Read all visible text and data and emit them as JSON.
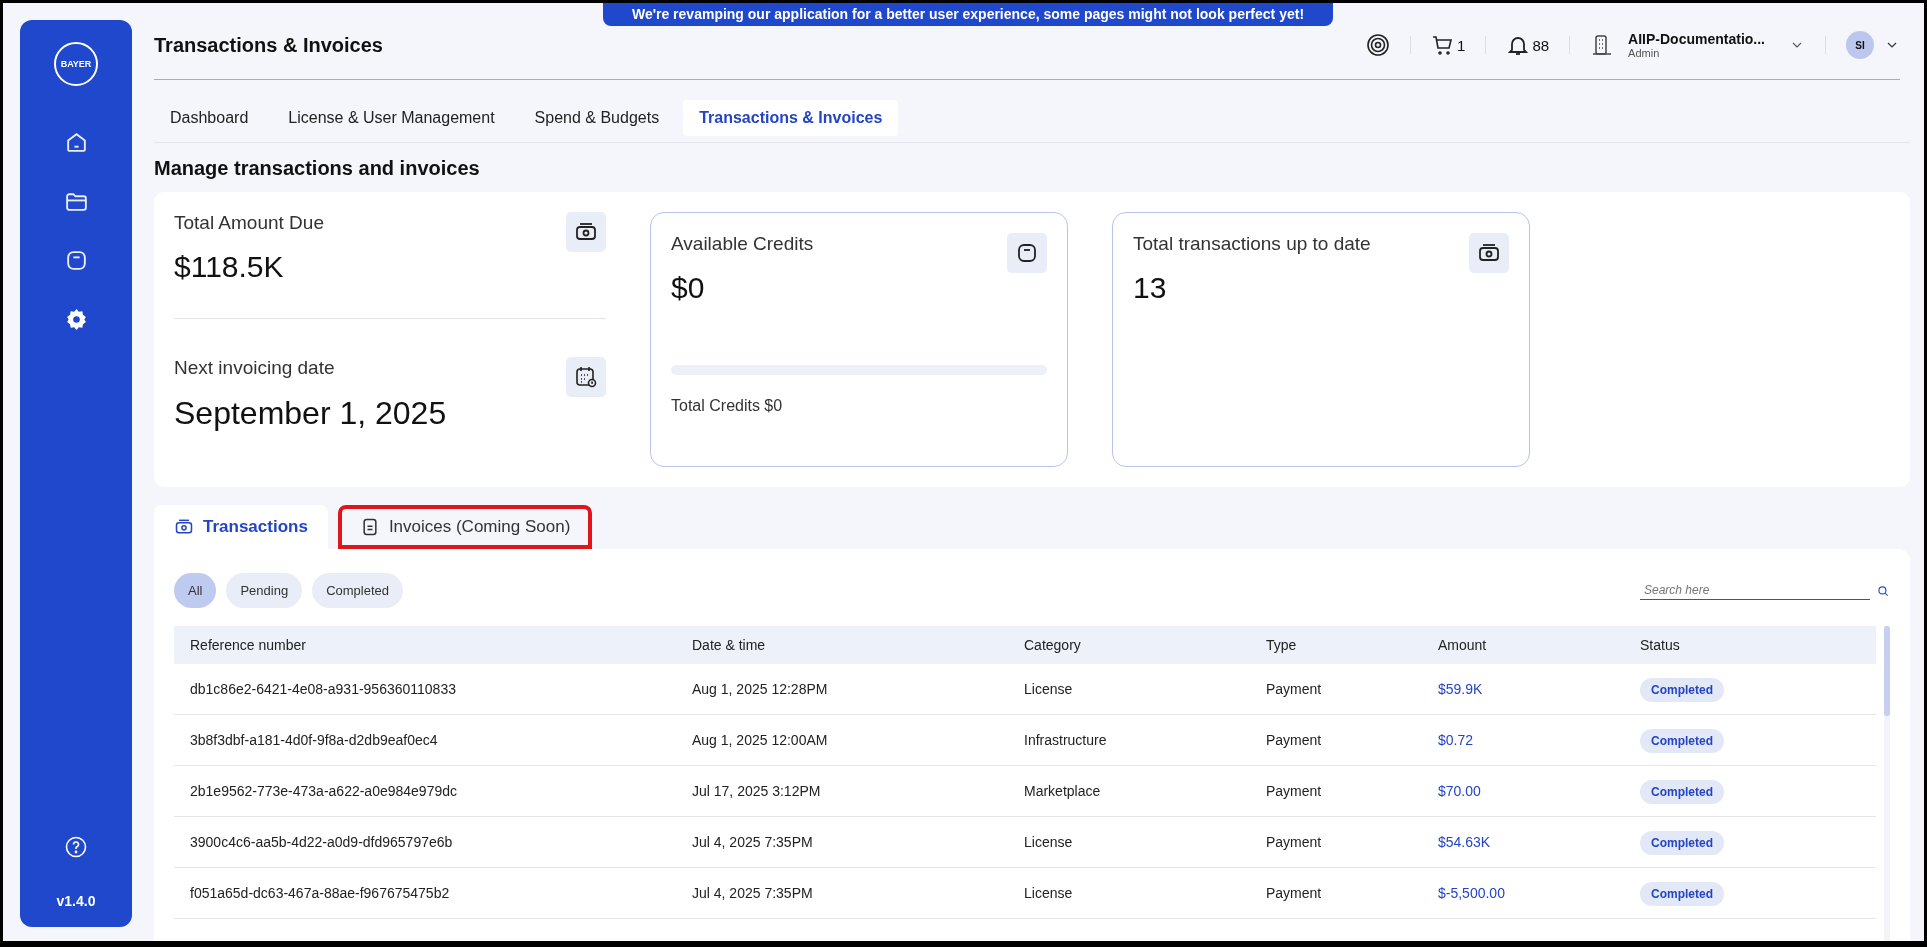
{
  "banner": "We're revamping our application for a better user experience, some pages might not look perfect yet!",
  "sidebar": {
    "logo": "BAYER",
    "items": [
      {
        "kind": "home",
        "selected": false
      },
      {
        "kind": "folder",
        "selected": false
      },
      {
        "kind": "bag",
        "selected": false
      },
      {
        "kind": "settings",
        "selected": true
      }
    ],
    "version": "v1.4.0"
  },
  "header": {
    "title": "Transactions & Invoices",
    "cart_count": "1",
    "notification_count": "88",
    "org": {
      "name": "AIIP-Documentatio...",
      "role": "Admin"
    },
    "avatar": "SI"
  },
  "nav_tabs": [
    {
      "label": "Dashboard",
      "selected": false
    },
    {
      "label": "License & User Management",
      "selected": false
    },
    {
      "label": "Spend & Budgets",
      "selected": false
    },
    {
      "label": "Transactions & Invoices",
      "selected": true
    }
  ],
  "heading": "Manage transactions and invoices",
  "summary": {
    "total_due": {
      "label": "Total Amount Due",
      "value": "$118.5K"
    },
    "next_invoice": {
      "label": "Next invoicing date",
      "value": "September 1, 2025"
    },
    "credits": {
      "label": "Available Credits",
      "value": "$0",
      "level": 0,
      "footer": "Total Credits $0"
    },
    "transactions": {
      "label": "Total transactions up to date",
      "value": "13"
    }
  },
  "section_tabs": [
    {
      "label": "Transactions",
      "kind": "money",
      "selected": true,
      "highlighted": false
    },
    {
      "label": "Invoices (Coming Soon)",
      "kind": "document",
      "selected": false,
      "highlighted": true
    }
  ],
  "filters": [
    {
      "label": "All",
      "selected": true
    },
    {
      "label": "Pending",
      "selected": false
    },
    {
      "label": "Completed",
      "selected": false
    }
  ],
  "search": {
    "placeholder": "Search here"
  },
  "table": {
    "columns": [
      "Reference number",
      "Date & time",
      "Category",
      "Type",
      "Amount",
      "Status"
    ],
    "rows": [
      {
        "reference": "db1c86e2-6421-4e08-a931-956360110833",
        "date": "Aug 1, 2025 12:28PM",
        "category": "License",
        "type": "Payment",
        "amount": "$59.9K",
        "status": "Completed"
      },
      {
        "reference": "3b8f3dbf-a181-4d0f-9f8a-d2db9eaf0ec4",
        "date": "Aug 1, 2025 12:00AM",
        "category": "Infrastructure",
        "type": "Payment",
        "amount": "$0.72",
        "status": "Completed"
      },
      {
        "reference": "2b1e9562-773e-473a-a622-a0e984e979dc",
        "date": "Jul 17, 2025 3:12PM",
        "category": "Marketplace",
        "type": "Payment",
        "amount": "$70.00",
        "status": "Completed"
      },
      {
        "reference": "3900c4c6-aa5b-4d22-a0d9-dfd965797e6b",
        "date": "Jul 4, 2025 7:35PM",
        "category": "License",
        "type": "Payment",
        "amount": "$54.63K",
        "status": "Completed"
      },
      {
        "reference": "f051a65d-dc63-467a-88ae-f967675475b2",
        "date": "Jul 4, 2025 7:35PM",
        "category": "License",
        "type": "Payment",
        "amount": "$-5,500.00",
        "status": "Completed"
      }
    ]
  }
}
